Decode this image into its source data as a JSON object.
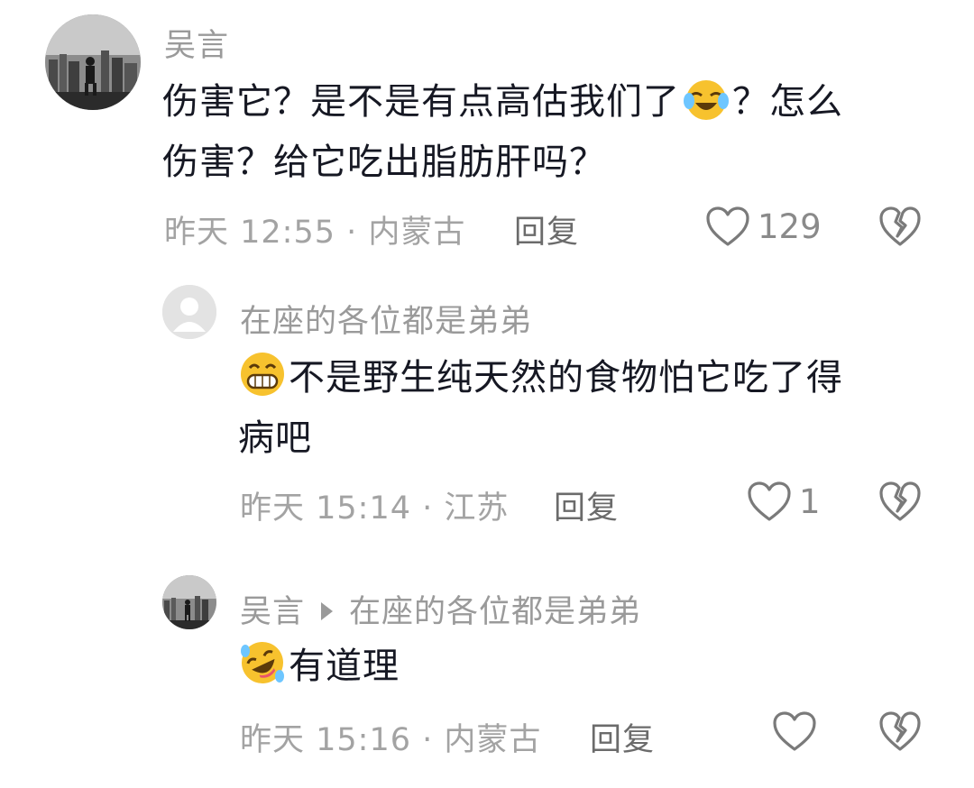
{
  "comments": [
    {
      "username": "吴言",
      "text_line1_a": "伤害它？是不是有点高估我们了",
      "text_line1_emoji": "crying-laughing-emoji",
      "text_line1_b": "？怎么",
      "text_line2": "伤害？给它吃出脂肪肝吗？",
      "time": "昨天 12:55",
      "location": "内蒙古",
      "meta_sep": " · ",
      "reply_label": "回复",
      "like_count": "129",
      "like_icon": "heart-outline-icon",
      "dislike_icon": "broken-heart-icon"
    },
    {
      "username": "在座的各位都是弟弟",
      "text_emoji": "grinning-emoji",
      "text_line1": "不是野生纯天然的食物怕它吃了得",
      "text_line2": "病吧",
      "time": "昨天 15:14",
      "location": "江苏",
      "meta_sep": " · ",
      "reply_label": "回复",
      "like_count": "1",
      "like_icon": "heart-outline-icon",
      "dislike_icon": "broken-heart-icon"
    },
    {
      "username": "吴言",
      "reply_to": "在座的各位都是弟弟",
      "text_emoji": "rolling-laughing-emoji",
      "text": "有道理",
      "time": "昨天 15:16",
      "location": "内蒙古",
      "meta_sep": " · ",
      "reply_label": "回复",
      "like_icon": "heart-outline-icon",
      "dislike_icon": "broken-heart-icon"
    }
  ],
  "colors": {
    "primary_text": "#161823",
    "secondary_text": "#9a9a9a",
    "reply_text": "#6b6b6b",
    "icon_gray": "#7a7a7a"
  }
}
